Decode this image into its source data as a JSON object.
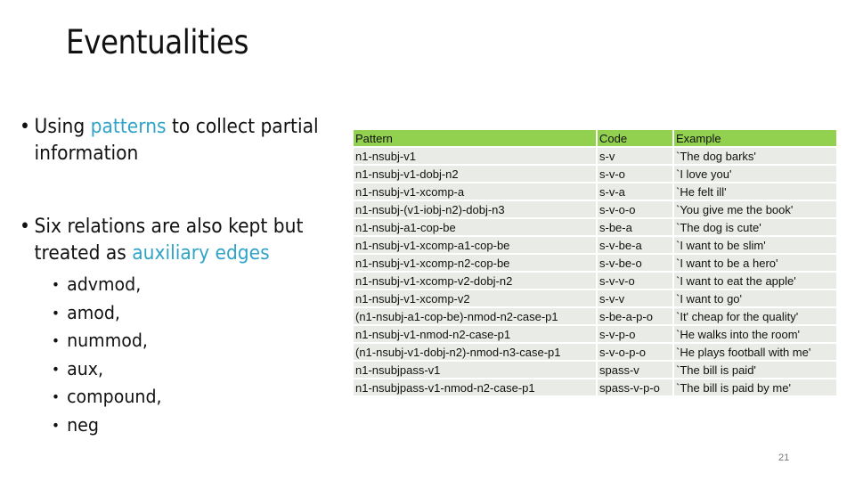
{
  "slide": {
    "title": "Eventualities",
    "page_number": "21",
    "accent_color": "#2fa3c8",
    "table_header_color": "#92d050",
    "table_row_color": "#e9ece6"
  },
  "bullets": [
    {
      "prefix": "Using ",
      "highlight": "patterns",
      "suffix": " to collect partial information"
    },
    {
      "prefix": "Six relations are also kept but treated as ",
      "highlight": "auxiliary edges",
      "suffix": "",
      "subitems": [
        "advmod,",
        "amod,",
        "nummod,",
        "aux,",
        "compound,",
        "neg"
      ]
    }
  ],
  "table": {
    "headers": [
      "Pattern",
      "Code",
      "Example"
    ],
    "rows": [
      [
        "n1-nsubj-v1",
        "s-v",
        "`The dog barks'"
      ],
      [
        "n1-nsubj-v1-dobj-n2",
        "s-v-o",
        "`I love you'"
      ],
      [
        "n1-nsubj-v1-xcomp-a",
        "s-v-a",
        "`He felt ill'"
      ],
      [
        "n1-nsubj-(v1-iobj-n2)-dobj-n3",
        "s-v-o-o",
        "`You give me the book'"
      ],
      [
        "n1-nsubj-a1-cop-be",
        "s-be-a",
        "`The dog is cute'"
      ],
      [
        "n1-nsubj-v1-xcomp-a1-cop-be",
        "s-v-be-a",
        "`I want to be slim'"
      ],
      [
        "n1-nsubj-v1-xcomp-n2-cop-be",
        "s-v-be-o",
        "`I want to be a hero'"
      ],
      [
        "n1-nsubj-v1-xcomp-v2-dobj-n2",
        "s-v-v-o",
        "`I want to eat the apple'"
      ],
      [
        "n1-nsubj-v1-xcomp-v2",
        "s-v-v",
        "`I want to go'"
      ],
      [
        "(n1-nsubj-a1-cop-be)-nmod-n2-case-p1",
        "s-be-a-p-o",
        "`It' cheap for the quality'"
      ],
      [
        "n1-nsubj-v1-nmod-n2-case-p1",
        "s-v-p-o",
        "`He walks into the room'"
      ],
      [
        "(n1-nsubj-v1-dobj-n2)-nmod-n3-case-p1",
        "s-v-o-p-o",
        "`He plays football with me'"
      ],
      [
        "n1-nsubjpass-v1",
        "spass-v",
        "`The bill is paid'"
      ],
      [
        "n1-nsubjpass-v1-nmod-n2-case-p1",
        "spass-v-p-o",
        "`The bill is paid by me'"
      ]
    ]
  }
}
